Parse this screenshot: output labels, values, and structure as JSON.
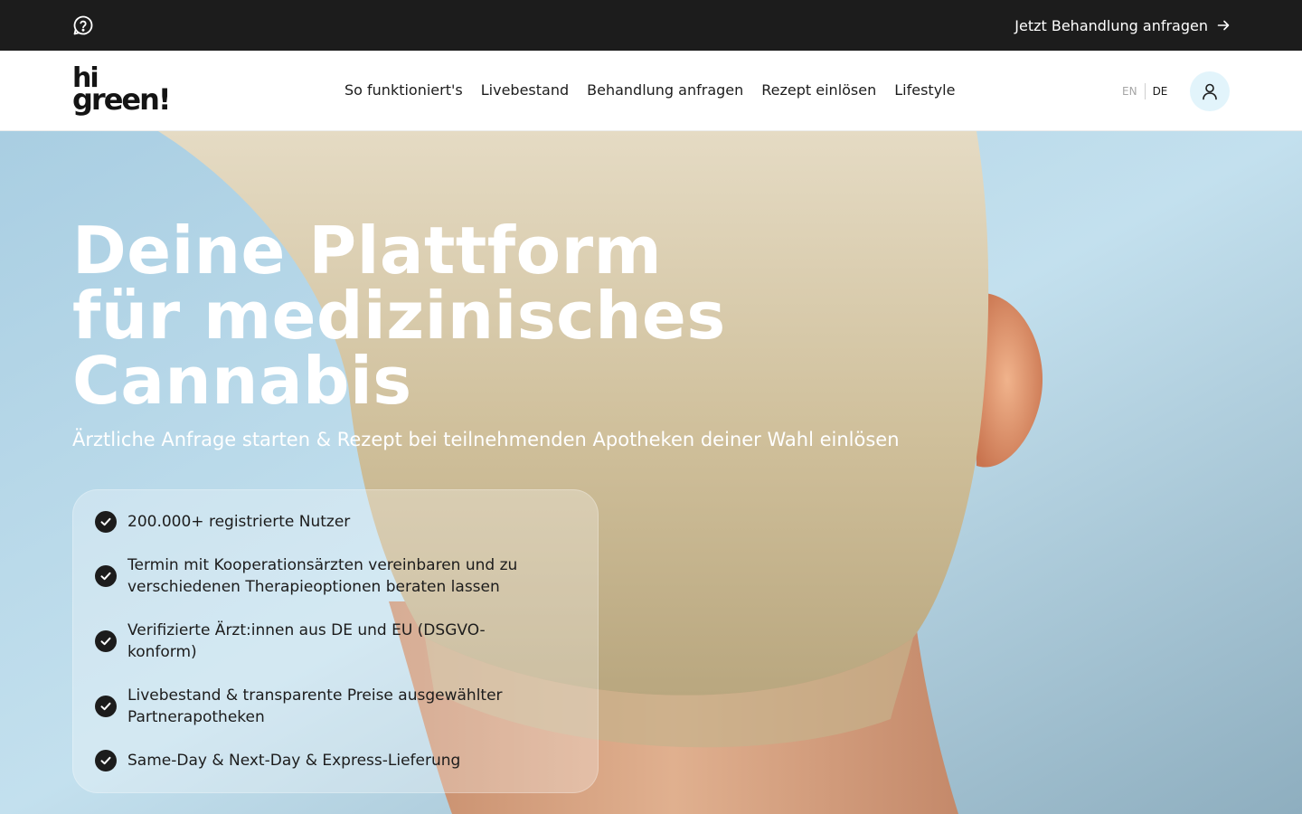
{
  "topbar": {
    "help_icon": "question-bubble-icon",
    "cta_label": "Jetzt Behandlung anfragen",
    "cta_icon": "arrow-right-icon"
  },
  "header": {
    "logo": {
      "line1": "hi",
      "line2": "green!"
    },
    "nav": [
      {
        "label": "So funktioniert's"
      },
      {
        "label": "Livebestand"
      },
      {
        "label": "Behandlung anfragen"
      },
      {
        "label": "Rezept einlösen"
      },
      {
        "label": "Lifestyle"
      }
    ],
    "language": {
      "options": [
        "EN",
        "DE"
      ],
      "active": "DE"
    },
    "account_icon": "user-icon"
  },
  "hero": {
    "title_lines": [
      "Deine Plattform",
      "für medizinisches",
      "Cannabis"
    ],
    "subtitle": "Ärztliche Anfrage starten & Rezept bei teilnehmenden Apotheken deiner Wahl einlösen",
    "features": [
      {
        "text": "200.000+ registrierte Nutzer"
      },
      {
        "text": "Termin mit Kooperationsärzten vereinbaren und zu verschiedenen Therapieoptionen beraten lassen"
      },
      {
        "text": "Verifizierte Ärzt:innen aus DE und EU (DSGVO-konform)"
      },
      {
        "text": "Livebestand & transparente Preise ausgewählter Partnerapotheken"
      },
      {
        "text": "Same-Day & Next-Day & Express-Lieferung"
      }
    ],
    "feature_icon": "check-circle-icon"
  },
  "colors": {
    "topbar_bg": "#1c1c1c",
    "account_button_bg": "#e2f4fb",
    "text_dark": "#1c1c1c",
    "hero_sky": "#b6d6e8",
    "hair": "#d7c9a8",
    "skin": "#e2a77f"
  }
}
